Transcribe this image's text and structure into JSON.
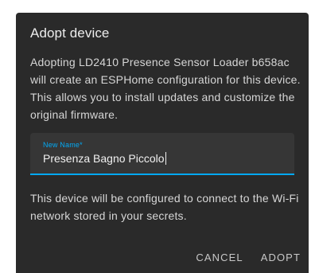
{
  "dialog": {
    "title": "Adopt device",
    "intro": "Adopting LD2410 Presence Sensor Loader b658ac will create an ESPHome configuration for this device. This allows you to install updates and customize the original firmware.",
    "name_field": {
      "label": "New Name*",
      "value": "Presenza Bagno Piccolo"
    },
    "note": "This device will be configured to connect to the Wi-Fi network stored in your secrets.",
    "cancel_label": "CANCEL",
    "adopt_label": "ADOPT"
  },
  "colors": {
    "dialog_bg": "#2a2a2a",
    "field_bg": "#363636",
    "accent": "#03a9f4"
  }
}
